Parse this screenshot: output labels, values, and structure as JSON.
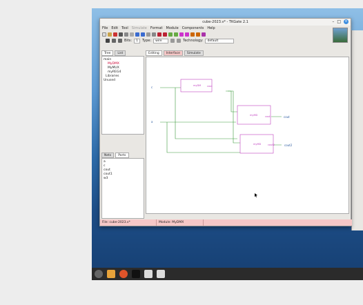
{
  "window": {
    "title": "cube-2023.v* - TKGate 2.1",
    "minimize": "–",
    "maximize": "□",
    "close": "×"
  },
  "menubar": [
    "File",
    "Edit",
    "Tool",
    "Simulate",
    "Format",
    "Module",
    "Components",
    "Help"
  ],
  "toolbar2": {
    "bits_label": "Bits:",
    "bits_value": "1",
    "type_label": "Type:",
    "type_value": "wire",
    "tech_label": "Technology:",
    "tech_value": "default"
  },
  "left_tabs": {
    "tree": "Tree",
    "list": "List"
  },
  "tree": {
    "items": [
      {
        "label": "main"
      },
      {
        "label": "MyDMX"
      },
      {
        "label": "MyMUX"
      },
      {
        "label": "myREG4"
      },
      {
        "label": "Libraries"
      },
      {
        "label": "Unused"
      }
    ]
  },
  "ports_tabs": {
    "nets": "Nets",
    "ports": "Ports"
  },
  "nets": [
    "a",
    "c",
    "cout",
    "cout1",
    "w3"
  ],
  "canvas_tabs": {
    "editing": "Editing",
    "interface": "Interface",
    "simulate": "Simulate"
  },
  "modules": [
    {
      "name": "myDM",
      "in1": "in",
      "out1": "cout"
    },
    {
      "name": "myMD",
      "out1": "cout"
    },
    {
      "name": "myMD",
      "out1": "cout2"
    }
  ],
  "signals": {
    "c": "c",
    "a": "a",
    "cout": "cout",
    "cout2": "cout2"
  },
  "status": {
    "file": "File: cube-2023.v*",
    "module": "Module: MyDMX"
  },
  "taskbar": [
    "menu",
    "files",
    "firefox",
    "terminal",
    "tkgate",
    "app"
  ],
  "colors": {
    "wire": "#3a9a3a",
    "module": "#c040c0",
    "status": "#f6c7c7"
  }
}
